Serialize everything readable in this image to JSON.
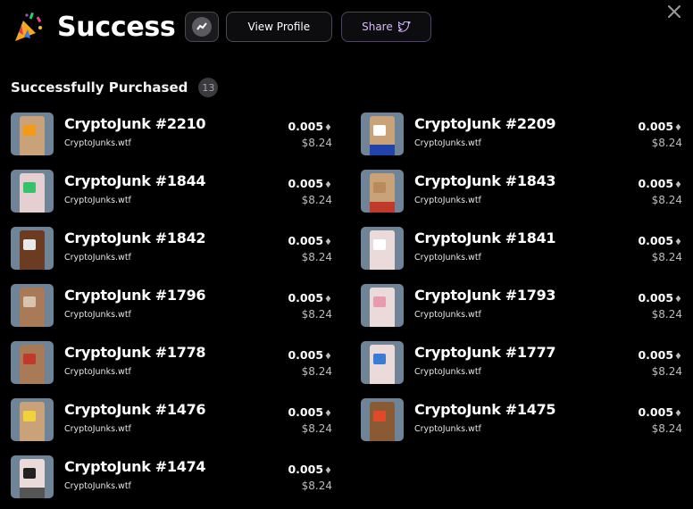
{
  "header": {
    "title": "Success",
    "view_profile_label": "View Profile",
    "share_label": "Share"
  },
  "section": {
    "title": "Successfully Purchased",
    "count": "13"
  },
  "currency_symbol": "♦",
  "items": [
    {
      "name": "CryptoJunk #2210",
      "collection": "CryptoJunks.wtf",
      "price_eth": "0.005",
      "price_usd": "$8.24",
      "skin": "#c9a27a",
      "accessory": "#f39a1a",
      "pants": "#c9a27a"
    },
    {
      "name": "CryptoJunk #2209",
      "collection": "CryptoJunks.wtf",
      "price_eth": "0.005",
      "price_usd": "$8.24",
      "skin": "#c9a27a",
      "accessory": "#ffffff",
      "pants": "#2244aa"
    },
    {
      "name": "CryptoJunk #1844",
      "collection": "CryptoJunks.wtf",
      "price_eth": "0.005",
      "price_usd": "$8.24",
      "skin": "#e6cfd0",
      "accessory": "#36c26b",
      "pants": "#e6cfd0"
    },
    {
      "name": "CryptoJunk #1843",
      "collection": "CryptoJunks.wtf",
      "price_eth": "0.005",
      "price_usd": "$8.24",
      "skin": "#c9a27a",
      "accessory": "#b88a5c",
      "pants": "#c0392b"
    },
    {
      "name": "CryptoJunk #1842",
      "collection": "CryptoJunks.wtf",
      "price_eth": "0.005",
      "price_usd": "$8.24",
      "skin": "#6b3b22",
      "accessory": "#e8e8e8",
      "pants": "#6b3b22"
    },
    {
      "name": "CryptoJunk #1841",
      "collection": "CryptoJunks.wtf",
      "price_eth": "0.005",
      "price_usd": "$8.24",
      "skin": "#eadada",
      "accessory": "#ffffff",
      "pants": "#eadada"
    },
    {
      "name": "CryptoJunk #1796",
      "collection": "CryptoJunks.wtf",
      "price_eth": "0.005",
      "price_usd": "$8.24",
      "skin": "#a97a57",
      "accessory": "#d9c4b0",
      "pants": "#a97a57"
    },
    {
      "name": "CryptoJunk #1793",
      "collection": "CryptoJunks.wtf",
      "price_eth": "0.005",
      "price_usd": "$8.24",
      "skin": "#eadada",
      "accessory": "#e89ab0",
      "pants": "#eadada"
    },
    {
      "name": "CryptoJunk #1778",
      "collection": "CryptoJunks.wtf",
      "price_eth": "0.005",
      "price_usd": "$8.24",
      "skin": "#a97a57",
      "accessory": "#c0392b",
      "pants": "#a97a57"
    },
    {
      "name": "CryptoJunk #1777",
      "collection": "CryptoJunks.wtf",
      "price_eth": "0.005",
      "price_usd": "$8.24",
      "skin": "#eadada",
      "accessory": "#3a7bd5",
      "pants": "#eadada"
    },
    {
      "name": "CryptoJunk #1476",
      "collection": "CryptoJunks.wtf",
      "price_eth": "0.005",
      "price_usd": "$8.24",
      "skin": "#c9a27a",
      "accessory": "#f1d23a",
      "pants": "#c9a27a"
    },
    {
      "name": "CryptoJunk #1475",
      "collection": "CryptoJunks.wtf",
      "price_eth": "0.005",
      "price_usd": "$8.24",
      "skin": "#8a5a34",
      "accessory": "#e04a2a",
      "pants": "#8a5a34"
    },
    {
      "name": "CryptoJunk #1474",
      "collection": "CryptoJunks.wtf",
      "price_eth": "0.005",
      "price_usd": "$8.24",
      "skin": "#eadada",
      "accessory": "#222222",
      "pants": "#555555"
    }
  ]
}
